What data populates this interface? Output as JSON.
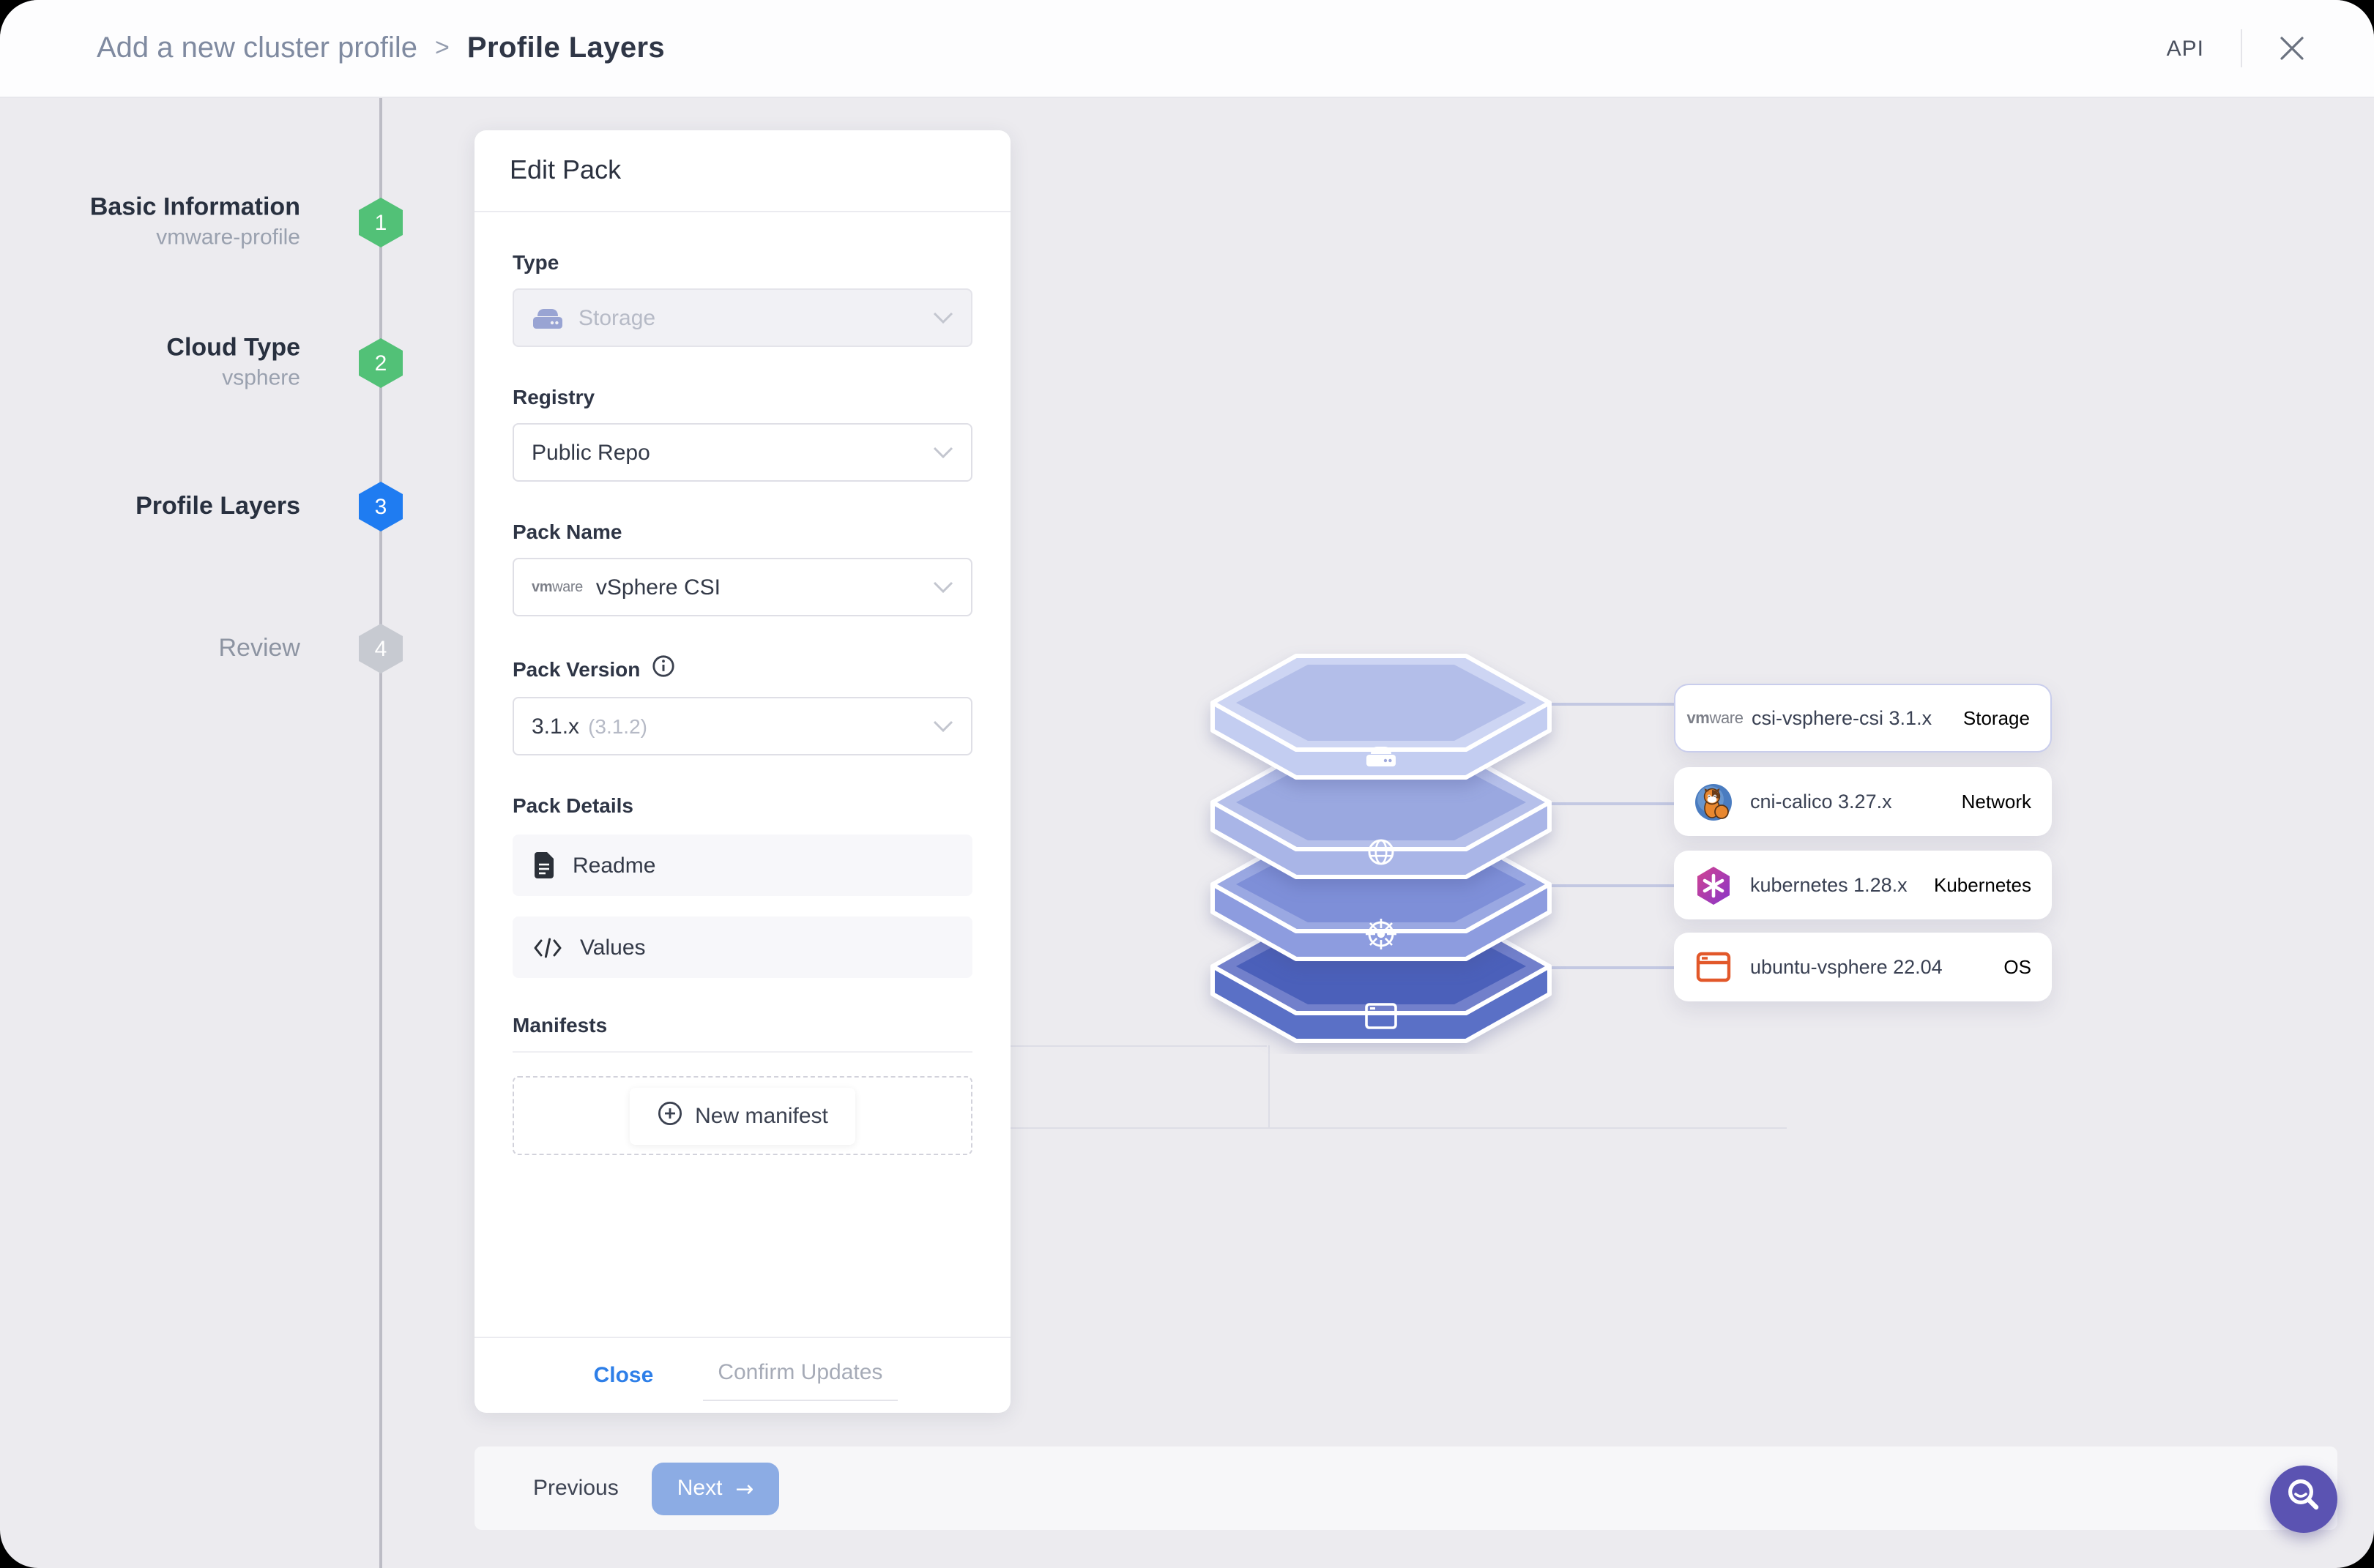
{
  "header": {
    "breadcrumb_parent": "Add a new cluster profile",
    "breadcrumb_separator": ">",
    "breadcrumb_current": "Profile Layers",
    "api_label": "API",
    "close_icon": "close-x-icon"
  },
  "stepper": {
    "items": [
      {
        "num": "1",
        "title": "Basic Information",
        "subtitle": "vmware-profile",
        "state": "completed"
      },
      {
        "num": "2",
        "title": "Cloud Type",
        "subtitle": "vsphere",
        "state": "completed"
      },
      {
        "num": "3",
        "title": "Profile Layers",
        "subtitle": "",
        "state": "active"
      },
      {
        "num": "4",
        "title": "Review",
        "subtitle": "",
        "state": "pending"
      }
    ],
    "badge_colors": {
      "completed": "#52c177",
      "active": "#1f7cf1",
      "pending": "#c7cad1"
    }
  },
  "edit_pack": {
    "title": "Edit Pack",
    "type": {
      "label": "Type",
      "value": "Storage",
      "icon": "storage-drive-icon",
      "disabled": true
    },
    "registry": {
      "label": "Registry",
      "value": "Public Repo"
    },
    "pack_name": {
      "label": "Pack Name",
      "value": "vSphere CSI",
      "icon": "vmware-wordmark",
      "vmware_bold": "vm",
      "vmware_rest": "ware"
    },
    "pack_version": {
      "label": "Pack Version",
      "value": "3.1.x",
      "hint": "(3.1.2)",
      "info_icon": "info-icon"
    },
    "pack_details": {
      "label": "Pack Details",
      "items": [
        {
          "label": "Readme",
          "icon": "document-icon"
        },
        {
          "label": "Values",
          "icon": "code-icon"
        }
      ]
    },
    "manifests": {
      "label": "Manifests",
      "new_button_label": "New manifest",
      "plus_icon": "plus-circle-icon"
    },
    "footer": {
      "close_label": "Close",
      "confirm_label": "Confirm Updates"
    }
  },
  "layer_stack": {
    "cards": [
      {
        "name": "csi-vsphere-csi 3.1.x",
        "category": "Storage",
        "icon": "vmware-wordmark",
        "selected": true,
        "category_color": "#b3b8d4"
      },
      {
        "name": "cni-calico 3.27.x",
        "category": "Network",
        "icon": "calico-logo",
        "selected": false,
        "category_color": "#7a82ac"
      },
      {
        "name": "kubernetes 1.28.x",
        "category": "Kubernetes",
        "icon": "kubernetes-logo",
        "selected": false,
        "category_color": "#3d4577"
      },
      {
        "name": "ubuntu-vsphere 22.04",
        "category": "OS",
        "icon": "ubuntu-window-icon",
        "selected": false,
        "category_color": "#3d4577"
      }
    ],
    "slabs": [
      {
        "icon": "storage-drive-icon",
        "rim": "#cdd5f3",
        "inner": "#b3bee9",
        "front": "#c3cdf1"
      },
      {
        "icon": "globe-icon",
        "rim": "#b6c0ea",
        "inner": "#9aa8e0",
        "front": "#a9b5e7"
      },
      {
        "icon": "kubernetes-wheel-icon",
        "rim": "#9aa8e2",
        "inner": "#7e8fd8",
        "front": "#8d9cdf"
      },
      {
        "icon": "os-window-icon",
        "rim": "#7280cb",
        "inner": "#4b60ba",
        "front": "#5a70c6"
      }
    ]
  },
  "wizard_footer": {
    "previous_label": "Previous",
    "next_label": "Next",
    "next_arrow": "→"
  },
  "fab": {
    "icon": "search-icon",
    "color": "#5b53b2"
  }
}
